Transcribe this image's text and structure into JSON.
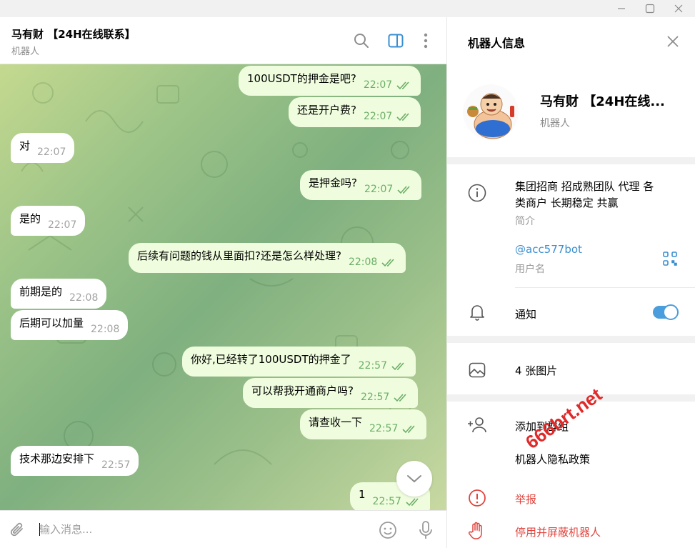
{
  "chat": {
    "title": "马有财 【24H在线联系】",
    "subtitle": "机器人"
  },
  "messages": [
    {
      "dir": "out",
      "text": "100USDT的押金是吧?",
      "time": "22:07"
    },
    {
      "dir": "out",
      "text": "还是开户费?",
      "time": "22:07"
    },
    {
      "dir": "in",
      "text": "对",
      "time": "22:07"
    },
    {
      "dir": "out",
      "text": "是押金吗?",
      "time": "22:07"
    },
    {
      "dir": "in",
      "text": "是的",
      "time": "22:07"
    },
    {
      "dir": "out",
      "text": "后续有问题的钱从里面扣?还是怎么样处理?",
      "time": "22:08"
    },
    {
      "dir": "in",
      "text": "前期是的",
      "time": "22:08"
    },
    {
      "dir": "in",
      "text": "后期可以加量",
      "time": "22:08"
    },
    {
      "dir": "out",
      "text": "你好,已经转了100USDT的押金了",
      "time": "22:57"
    },
    {
      "dir": "out",
      "text": "可以帮我开通商户吗?",
      "time": "22:57"
    },
    {
      "dir": "out",
      "text": "请查收一下",
      "time": "22:57"
    },
    {
      "dir": "in",
      "text": "技术那边安排下",
      "time": "22:57"
    },
    {
      "dir": "out",
      "text": "1",
      "time": "22:57"
    }
  ],
  "input": {
    "placeholder": "输入消息..."
  },
  "panel": {
    "title": "机器人信息",
    "profile_name": "马有财 【24H在线...",
    "profile_sub": "机器人",
    "bio_line1": "集团招商 招成熟团队 代理 各",
    "bio_line2": "类商户 长期稳定 共赢",
    "bio_label": "简介",
    "username": "@acc577bot",
    "username_label": "用户名",
    "notifications_label": "通知",
    "notifications_on": true,
    "photos_label": "4 张图片",
    "add_to_group": "添加到群组",
    "privacy_policy": "机器人隐私政策",
    "report": "举报",
    "block": "停用并屏蔽机器人"
  },
  "colors": {
    "accent": "#4a9edd",
    "danger": "#e0453e",
    "outgoing_bubble": "#effdde",
    "link": "#3a8fd1"
  },
  "watermark": "666brt.net"
}
